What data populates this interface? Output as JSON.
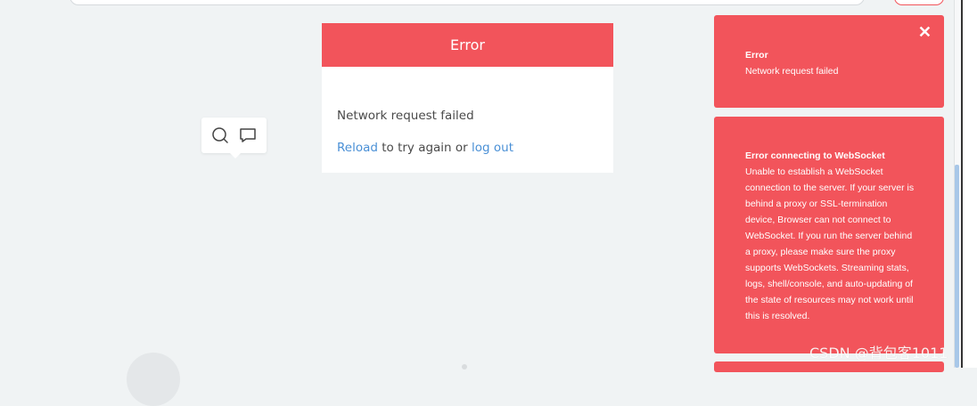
{
  "error_card": {
    "title": "Error",
    "message": "Network request failed",
    "reload_link": "Reload",
    "middle_text": " to try again or ",
    "logout_link": "log out"
  },
  "bubble": {
    "search_icon": "search-icon",
    "comment_icon": "comment-icon"
  },
  "toasts": [
    {
      "close": "✕",
      "title": "Error",
      "body": "Network request failed"
    },
    {
      "title": "Error connecting to WebSocket",
      "body": "Unable to establish a WebSocket connection to the server. If your server is behind a proxy or SSL-termination device, Browser can not connect to WebSocket. If you run the server behind a proxy, please make sure the proxy supports WebSockets. Streaming stats, logs, shell/console, and auto-updating of the state of resources may not work until this is resolved."
    }
  ],
  "watermark": "CSDN @背包客1011",
  "colors": {
    "error_red": "#f2545b",
    "link_blue": "#4a90d6",
    "background": "#f0f3f4"
  }
}
